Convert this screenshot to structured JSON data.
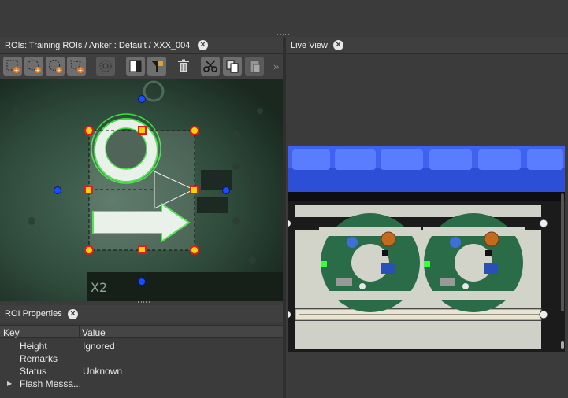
{
  "roi_panel": {
    "title": "ROIs: Training ROIs / Anker : Default / XXX_004",
    "toolbar": {
      "icons": [
        "rect-select-icon",
        "ellipse-select-icon",
        "circle-select-icon",
        "polygon-select-icon",
        "ring-select-icon",
        "invert-icon",
        "filter-icon",
        "delete-icon",
        "cut-icon",
        "copy-icon",
        "paste-icon",
        "more-icon"
      ],
      "overflow": "»"
    }
  },
  "live_view": {
    "title": "Live View"
  },
  "roi_properties": {
    "title": "ROI Properties",
    "columns": {
      "key": "Key",
      "value": "Value"
    },
    "rows": [
      {
        "key": "Height",
        "value": "Ignored"
      },
      {
        "key": "Remarks",
        "value": ""
      },
      {
        "key": "Status",
        "value": "Unknown"
      },
      {
        "key": "Flash Messa...",
        "value": "",
        "expandable": true
      }
    ]
  },
  "colors": {
    "panel_bg": "#3b3b3b",
    "handle_red": "#e21a1a",
    "handle_yellow": "#f3d20a",
    "handle_blue": "#1a4cff",
    "roi_green": "#39e23b"
  }
}
